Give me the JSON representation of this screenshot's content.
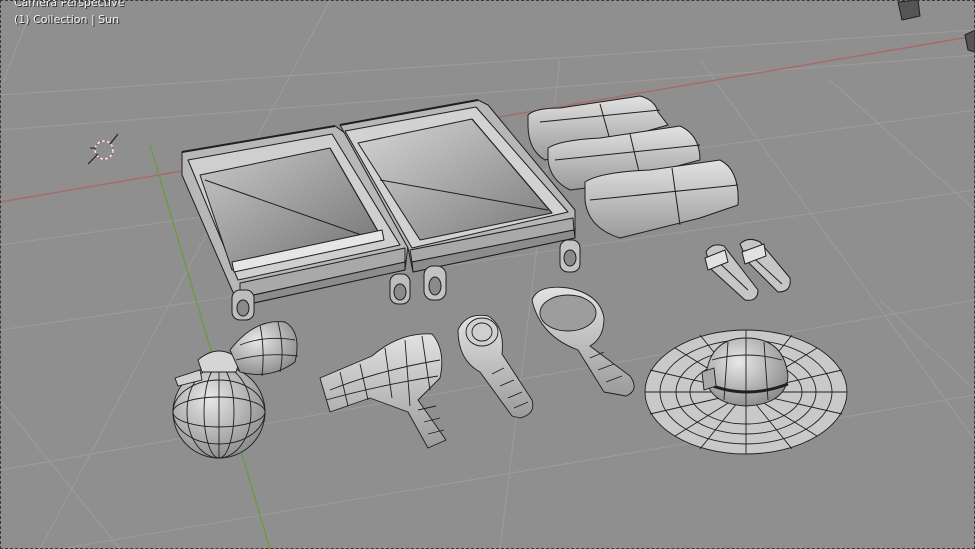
{
  "viewport": {
    "view_name": "Camera Perspective",
    "scene_info": "(1) Collection | Sun"
  },
  "objects": [
    {
      "name": "suitcase",
      "icon": "suitcase-mesh"
    },
    {
      "name": "folded-clothes",
      "icon": "clothes-mesh"
    },
    {
      "name": "sandals",
      "icon": "sandals-mesh"
    },
    {
      "name": "perfume-bottle",
      "icon": "bottle-mesh"
    },
    {
      "name": "hair-dryer",
      "icon": "dryer-mesh"
    },
    {
      "name": "hair-brush",
      "icon": "brush-mesh"
    },
    {
      "name": "hand-mirror",
      "icon": "mirror-mesh"
    },
    {
      "name": "sun-hat",
      "icon": "hat-mesh"
    }
  ],
  "colors": {
    "background": "#8f8f8f",
    "grid": "#9c9c9c",
    "x_axis": "#a86a6a",
    "y_axis": "#6d9a45",
    "wire": "#1f1f1f",
    "mesh_light": "#d8d8d8",
    "mesh_dark": "#6e6e6e"
  }
}
